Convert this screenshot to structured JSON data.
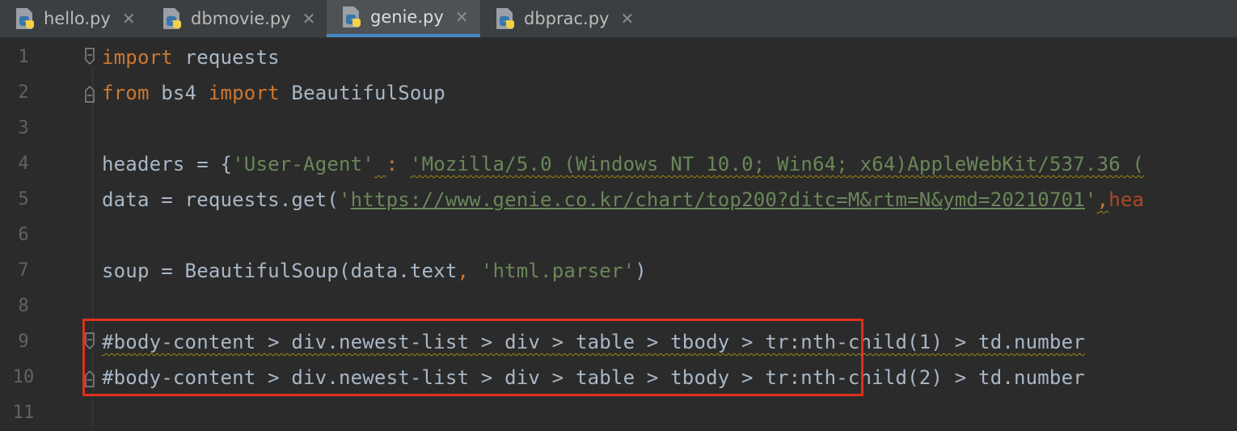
{
  "tabs": [
    {
      "label": "hello.py",
      "active": false
    },
    {
      "label": "dbmovie.py",
      "active": false
    },
    {
      "label": "genie.py",
      "active": true
    },
    {
      "label": "dbprac.py",
      "active": false
    }
  ],
  "line_numbers": [
    "1",
    "2",
    "3",
    "4",
    "5",
    "6",
    "7",
    "8",
    "9",
    "10",
    "11"
  ],
  "code": {
    "line1": {
      "kw": "import",
      "rest": " requests"
    },
    "line2": {
      "kw1": "from",
      "mod": " bs4 ",
      "kw2": "import",
      "rest": " BeautifulSoup"
    },
    "line4": {
      "prefix": "headers = {",
      "key": "'User-Agent'",
      "space": " ",
      "colon": ":",
      "sep": " ",
      "value": "'Mozilla/5.0 (Windows NT 10.0; Win64; x64)AppleWebKit/537.36 ("
    },
    "line5": {
      "prefix": "data = requests.get(",
      "quote_open": "'",
      "url": "https://www.genie.co.kr/chart/top200?ditc=M&rtm=N&ymd=20210701",
      "quote_close": "'",
      "comma": ",",
      "param": "hea"
    },
    "line7": {
      "prefix": "soup = BeautifulSoup(data.text",
      "comma": ",",
      "space": " ",
      "str": "'html.parser'",
      "suffix": ")"
    },
    "line9": "#body-content > div.newest-list > div > table > tbody > tr:nth-child(1) > td.number",
    "line10": "#body-content > div.newest-list > div > table > tbody > tr:nth-child(2) > td.number"
  },
  "colors": {
    "background": "#2b2b2b",
    "keyword": "#cc7832",
    "string": "#6a8759",
    "text": "#a9b7c6",
    "highlight_box": "#e0301e",
    "active_tab_underline": "#4a88c7"
  },
  "icons": {
    "tab_file": "python-file-icon",
    "tab_close": "close-icon",
    "fold_marker": "fold-marker-icon"
  }
}
